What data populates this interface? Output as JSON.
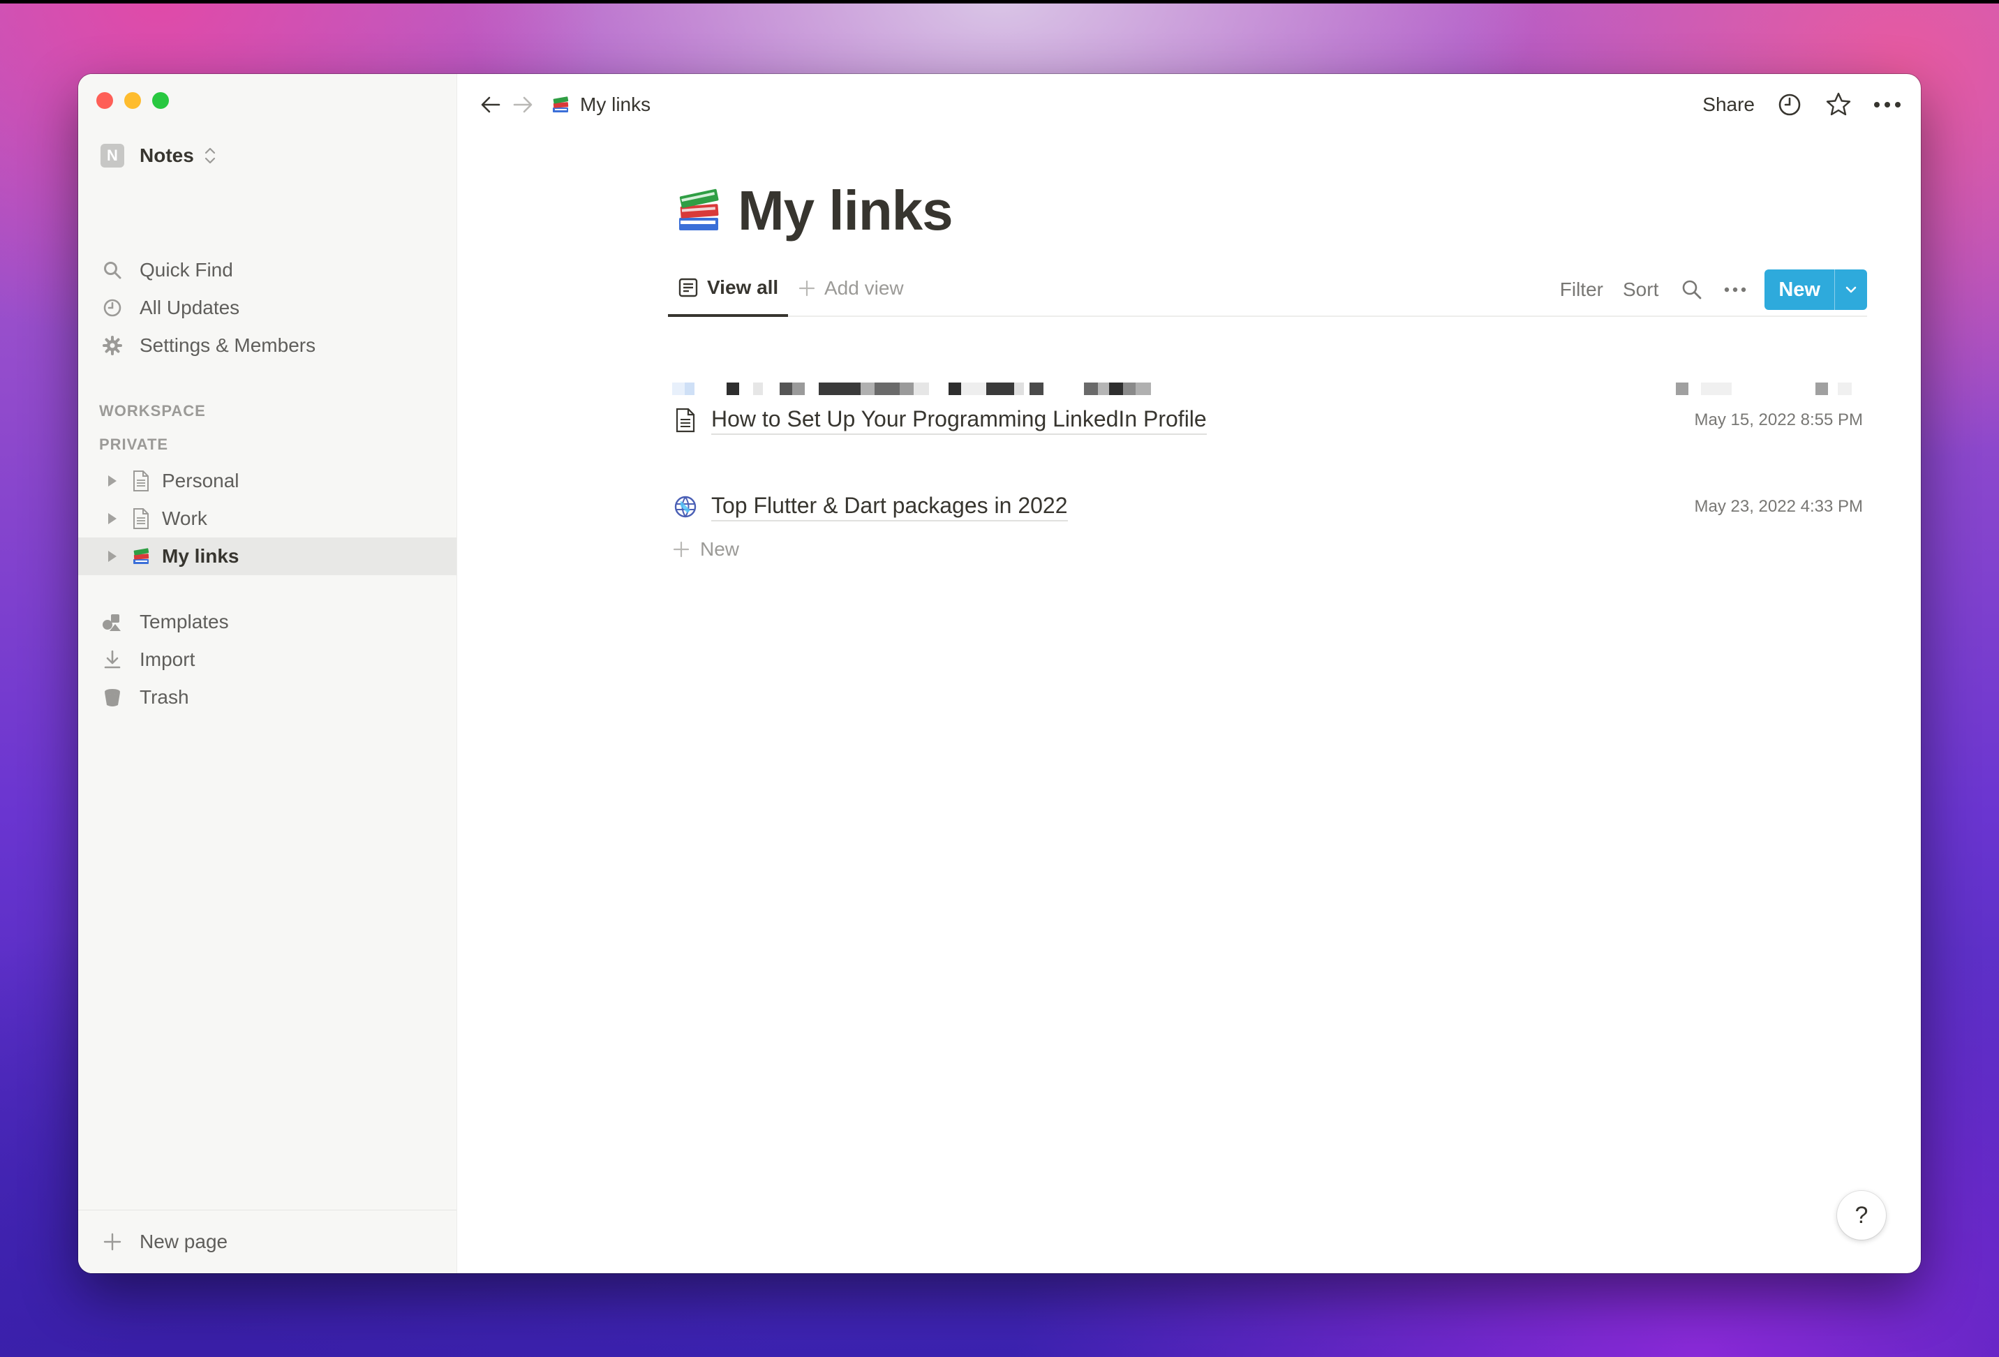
{
  "workspace": {
    "avatar_letter": "N",
    "name": "Notes"
  },
  "sidebar": {
    "quick_find": "Quick Find",
    "all_updates": "All Updates",
    "settings": "Settings & Members",
    "section_workspace": "WORKSPACE",
    "section_private": "PRIVATE",
    "pages": [
      {
        "label": "Personal",
        "icon": "page-icon"
      },
      {
        "label": "Work",
        "icon": "page-icon"
      },
      {
        "label": "My links",
        "icon": "books-emoji-icon",
        "active": true
      }
    ],
    "templates": "Templates",
    "import": "Import",
    "trash": "Trash",
    "new_page": "New page"
  },
  "topbar": {
    "breadcrumb": "My links",
    "share": "Share"
  },
  "page": {
    "title": "My links"
  },
  "viewbar": {
    "active_view": "View all",
    "add_view": "Add view",
    "filter": "Filter",
    "sort": "Sort",
    "new_button": "New"
  },
  "rows": [
    {
      "title": "How to Set Up Your Programming LinkedIn Profile",
      "date": "May 15, 2022 8:55 PM",
      "icon": "page-icon"
    },
    {
      "title": "Top Flutter & Dart packages in 2022",
      "date": "May 23, 2022 4:33 PM",
      "icon": "flutter-globe-icon"
    }
  ],
  "add_row": "New",
  "help": "?",
  "colors": {
    "accent": "#2eaadc",
    "text": "#37352f",
    "muted": "#9b9a97",
    "sidebar_bg": "#f7f7f5"
  }
}
